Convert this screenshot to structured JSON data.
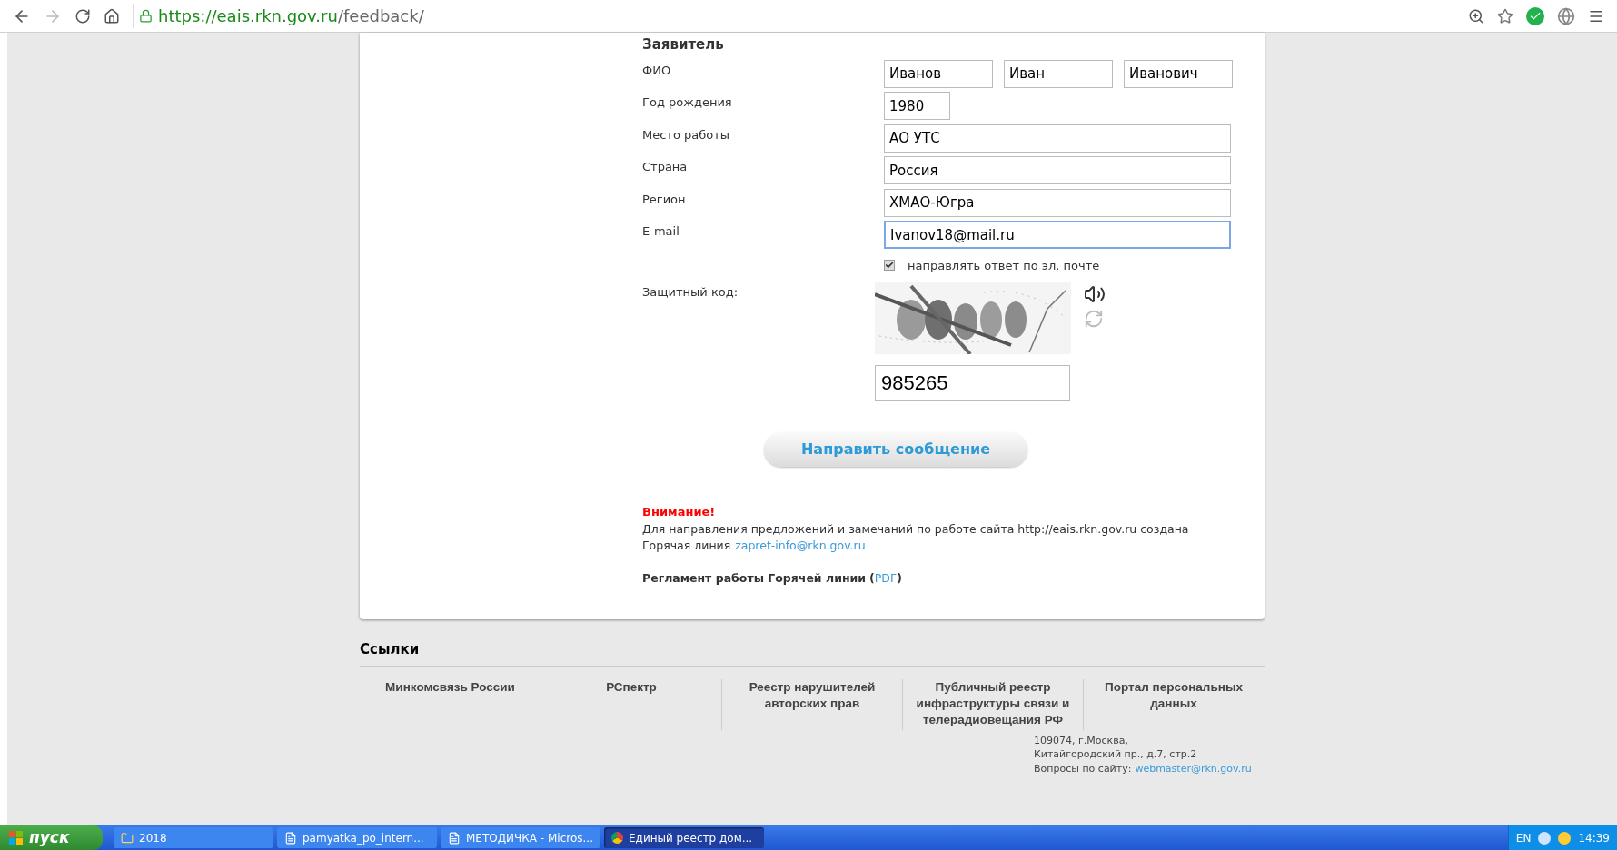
{
  "browser": {
    "url_host": "https://eais.rkn.gov.ru",
    "url_path": "/feedback/"
  },
  "form": {
    "section_title": "Заявитель",
    "rows": [
      {
        "label": "ФИО",
        "fields": [
          {
            "value": "Иванов",
            "kind": "third",
            "focused": false
          },
          {
            "value": "Иван",
            "kind": "third",
            "focused": false
          },
          {
            "value": "Иванович",
            "kind": "third",
            "focused": false
          }
        ]
      },
      {
        "label": "Год рождения",
        "fields": [
          {
            "value": "1980",
            "kind": "short",
            "focused": false
          }
        ]
      },
      {
        "label": "Место работы",
        "fields": [
          {
            "value": "АО УТС",
            "kind": "full",
            "focused": false
          }
        ]
      },
      {
        "label": "Страна",
        "fields": [
          {
            "value": "Россия",
            "kind": "full",
            "focused": false
          }
        ]
      },
      {
        "label": "Регион",
        "fields": [
          {
            "value": "ХМАО-Югра",
            "kind": "full",
            "focused": false
          }
        ]
      },
      {
        "label": "E-mail",
        "fields": [
          {
            "value": "Ivanov18@mail.ru",
            "kind": "full",
            "focused": true
          }
        ]
      }
    ],
    "email_reply": {
      "label": "направлять ответ по эл. почте",
      "checked": true
    },
    "captcha": {
      "label": "Защитный код:",
      "value": "985265"
    },
    "submit": "Направить сообщение",
    "notice": {
      "title": "Внимание!",
      "text": "Для направления предложений и замечаний по работе сайта http://eais.rkn.gov.ru создана",
      "line2": "Горячая линия",
      "email": "zapret-info@rkn.gov.ru",
      "rules": "Регламент работы Горячей линии",
      "rules_open": "(",
      "rules_link": "PDF",
      "rules_close": ")"
    }
  },
  "footer": {
    "title": "Ссылки",
    "links": [
      "Минкомсвязь России",
      "РСпектр",
      "Реестр нарушителей авторских прав",
      "Публичный реестр инфраструктуры связи и телерадиовещания РФ",
      "Портал персональных данных"
    ],
    "address": [
      "109074, г.Москва,",
      "Китайгородский пр., д.7, стр.2"
    ],
    "questions": "Вопросы по сайту:",
    "webmaster": "webmaster@rkn.gov.ru"
  },
  "taskbar": {
    "start": "пуск",
    "items": [
      {
        "label": "2018",
        "kind": "folder",
        "selected": false
      },
      {
        "label": "pamyatka_po_intern...",
        "kind": "doc",
        "selected": false
      },
      {
        "label": "МЕТОДИЧКА - Micros...",
        "kind": "doc",
        "selected": false
      },
      {
        "label": "Единый реестр дом...",
        "kind": "browser",
        "selected": true
      }
    ],
    "lang": "EN",
    "clock": "14:39"
  }
}
